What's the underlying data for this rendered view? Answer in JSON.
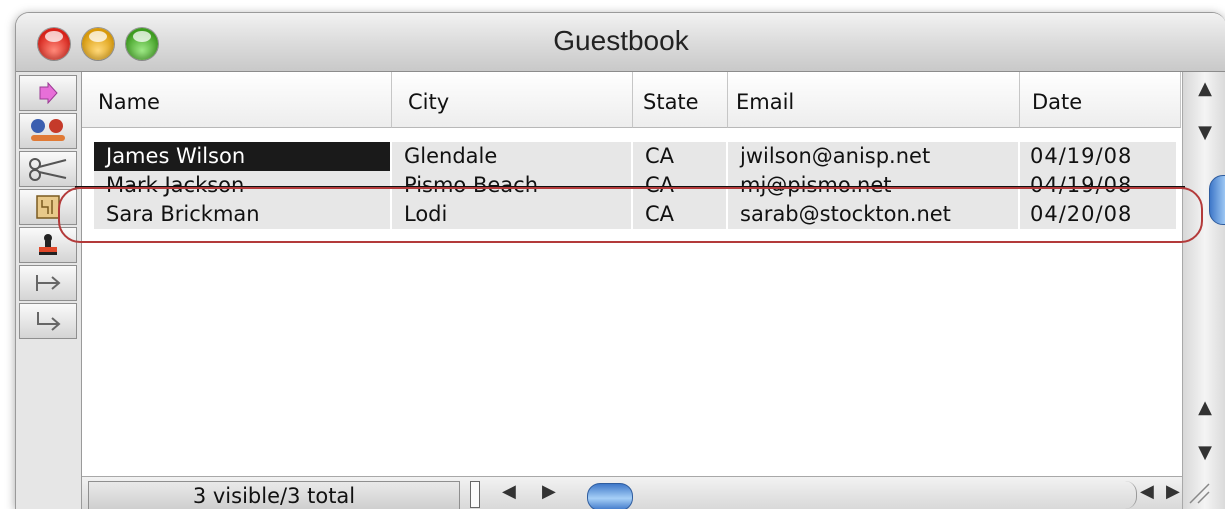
{
  "window": {
    "title": "Guestbook"
  },
  "toolbar": {
    "tools": [
      {
        "name": "pointer-tool",
        "icon": "pink-arrow-icon"
      },
      {
        "name": "group-tool",
        "icon": "people-icon"
      },
      {
        "name": "scissors-tool",
        "icon": "scissors-icon"
      },
      {
        "name": "form-tool",
        "icon": "form-icon"
      },
      {
        "name": "stamp-tool",
        "icon": "stamp-icon"
      },
      {
        "name": "tab-tool",
        "icon": "tab-arrow-icon"
      },
      {
        "name": "return-tool",
        "icon": "return-arrow-icon"
      }
    ]
  },
  "table": {
    "columns": [
      "Name",
      "City",
      "State",
      "Email",
      "Date"
    ],
    "rows": [
      {
        "name": "James Wilson",
        "city": "Glendale",
        "state": "CA",
        "email": "jwilson@anisp.net",
        "date": "04/19/08",
        "selected": true
      },
      {
        "name": "Mark Jackson",
        "city": "Pismo Beach",
        "state": "CA",
        "email": "mj@pismo.net",
        "date": "04/19/08",
        "struck": true
      },
      {
        "name": "Sara Brickman",
        "city": "Lodi",
        "state": "CA",
        "email": "sarab@stockton.net",
        "date": "04/20/08",
        "highlighted": true
      }
    ]
  },
  "status": {
    "text": "3 visible/3 total"
  },
  "colors": {
    "selection": "#1a1a1a",
    "highlight_oval": "#b33a3a",
    "scroll_thumb": "#5b8fd6"
  }
}
